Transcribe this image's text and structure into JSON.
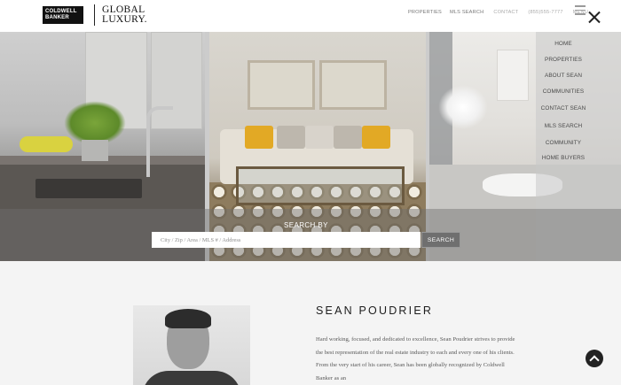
{
  "brand": {
    "coldwell_line1": "COLDWELL",
    "coldwell_line2": "BANKER",
    "global_line1": "GLOBAL",
    "global_line2": "LUXURY."
  },
  "top_nav": {
    "items": [
      {
        "label": "PROPERTIES"
      },
      {
        "label": "MLS SEARCH"
      },
      {
        "label": "CONTACT"
      },
      {
        "label": "(855)555-7777"
      },
      {
        "label": "MENU"
      }
    ]
  },
  "side_menu": {
    "items": [
      {
        "label": "HOME"
      },
      {
        "label": "PROPERTIES"
      },
      {
        "label": "ABOUT SEAN"
      },
      {
        "label": "COMMUNITIES"
      },
      {
        "label": "CONTACT SEAN"
      },
      {
        "label": "MLS SEARCH"
      },
      {
        "label": "COMMUNITY"
      },
      {
        "label": "HOME BUYERS"
      }
    ]
  },
  "search": {
    "label": "SEARCH BY",
    "placeholder": "City / Zip / Area / MLS # / Address",
    "button": "SEARCH"
  },
  "agent": {
    "name": "SEAN POUDRIER",
    "bio": "Hard working, focused, and dedicated to excellence, Sean Poudrier strives to provide the best representation of the real estate industry to each and every one of his clients. From the very start of his career, Sean has been globally recognized by Coldwell Banker as an"
  }
}
